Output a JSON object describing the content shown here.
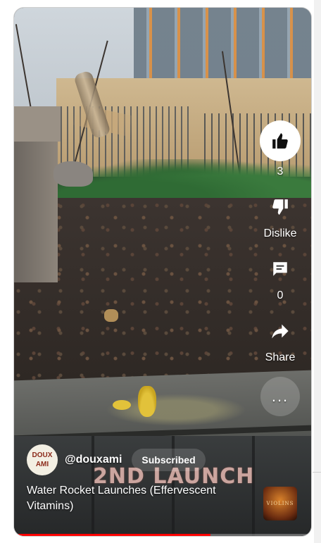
{
  "actions": {
    "like_count": "3",
    "dislike_label": "Dislike",
    "comment_count": "0",
    "share_label": "Share",
    "more_label": "..."
  },
  "video_overlay_text": "2ND LAUNCH",
  "channel": {
    "avatar_line1": "DOUX",
    "avatar_line2": "AMI",
    "handle": "@douxami",
    "subscribe_label": "Subscribed"
  },
  "video": {
    "title": "Water Rocket Launches (Effervescent Vitamins)",
    "music_thumb_text": "VIOLINS",
    "progress": 0.66
  },
  "colors": {
    "progress": "#ff0000",
    "overlay_title": "#e6b9b2"
  },
  "icons": [
    "thumbs-up-icon",
    "thumbs-down-icon",
    "comment-icon",
    "share-icon",
    "more-icon"
  ]
}
